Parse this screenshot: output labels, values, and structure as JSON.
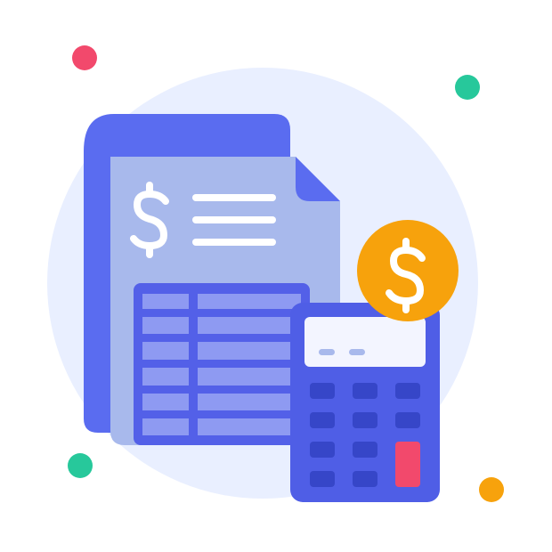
{
  "illustration": {
    "subject": "invoice-document-with-calculator",
    "icons": [
      "dollar-sign-icon",
      "calculator-icon",
      "document-icon",
      "table-grid-icon"
    ],
    "colors": {
      "background": "#ffffff",
      "halo": "#e9efff",
      "document_back": "#5a6cf0",
      "document_front": "#a8b9ec",
      "document_fold": "#5a6cf0",
      "text_lines": "#ffffff",
      "table_border": "#5360e8",
      "table_cell": "#8e9af2",
      "calculator_body": "#4f5ee6",
      "calculator_screen": "#f3f5ff",
      "calculator_keys": "#3646c8",
      "calculator_accent_key": "#f2496c",
      "coin": "#f7a20c",
      "dot_red": "#f2496c",
      "dot_green": "#27c89b",
      "dot_orange": "#f7a20c"
    }
  }
}
